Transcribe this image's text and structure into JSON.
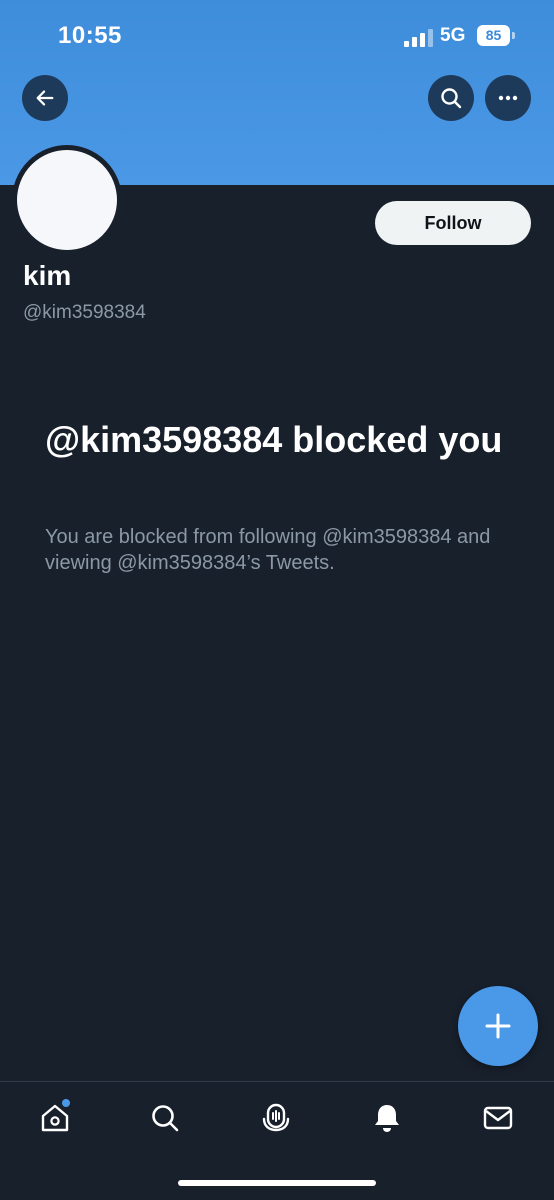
{
  "status_bar": {
    "time": "10:55",
    "network": "5G",
    "battery": "85"
  },
  "header": {
    "back_icon": "arrow-left-icon",
    "search_icon": "search-icon",
    "more_icon": "more-horizontal-icon"
  },
  "profile": {
    "display_name": "kim",
    "handle": "@kim3598384",
    "follow_label": "Follow"
  },
  "blocked_notice": {
    "title": "@kim3598384 blocked you",
    "description": "You are blocked from following @kim3598384 and viewing @kim3598384’s Tweets."
  },
  "compose": {
    "icon": "plus-icon"
  },
  "bottom_nav": {
    "items": [
      {
        "icon": "home-icon"
      },
      {
        "icon": "search-icon"
      },
      {
        "icon": "spaces-icon"
      },
      {
        "icon": "bell-icon"
      },
      {
        "icon": "mail-icon"
      }
    ]
  },
  "colors": {
    "background": "#18202c",
    "banner": "#4a98e6",
    "accent": "#4a99e9",
    "secondary_text": "#8b98a5"
  }
}
